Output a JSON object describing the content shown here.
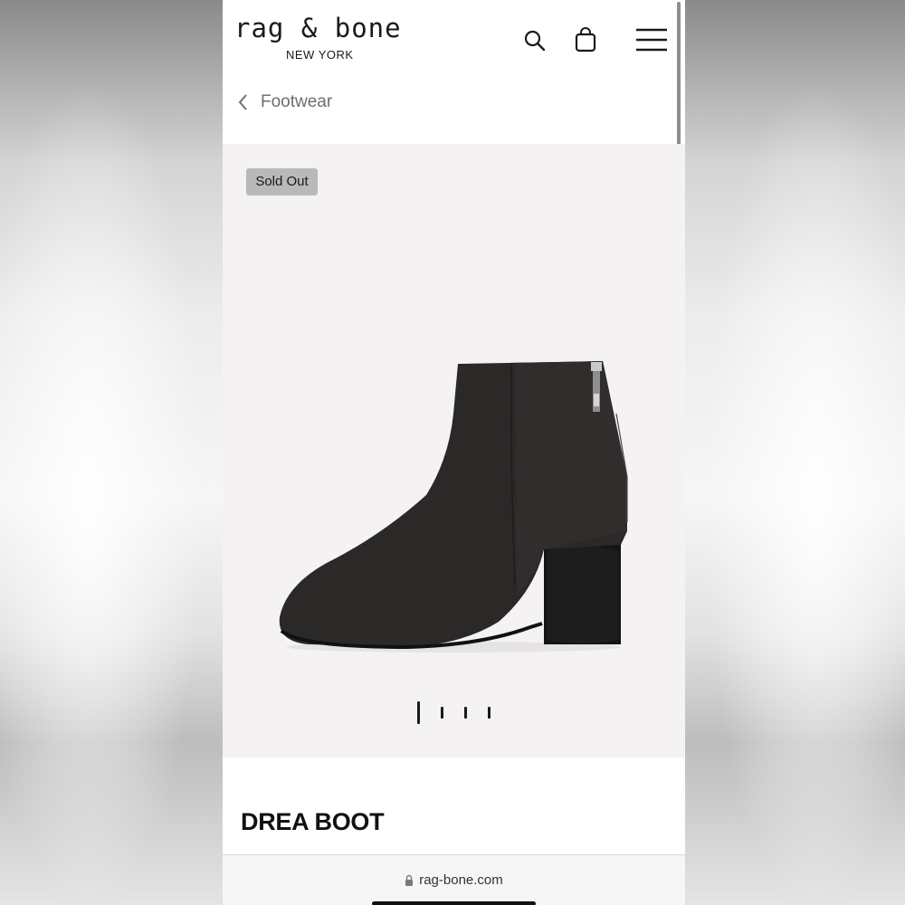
{
  "header": {
    "logo_main": "rag & bone",
    "logo_sub": "NEW YORK",
    "icons": [
      "search-icon",
      "bag-icon",
      "menu-icon"
    ]
  },
  "breadcrumb": {
    "label": "Footwear",
    "icon": "chevron-left-icon"
  },
  "gallery": {
    "badge": "Sold Out",
    "image": "black suede ankle boot with block heel",
    "page_count": 4,
    "current_page": 1
  },
  "product": {
    "title": "DREA BOOT"
  },
  "browser": {
    "url": "rag-bone.com",
    "icon": "lock-icon"
  },
  "colors": {
    "gallery_bg": "#f4f2f3",
    "badge_bg": "#b9b9b9",
    "text": "#111111",
    "breadcrumb_text": "#6f6f6f"
  }
}
